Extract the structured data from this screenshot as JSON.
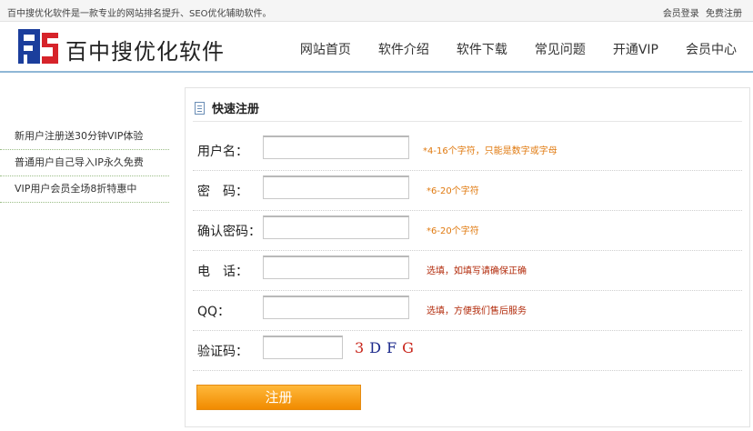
{
  "topbar": {
    "tagline": "百中搜优化软件是一款专业的网站排名提升、SEO优化辅助软件。",
    "links": [
      "会员登录",
      "免费注册"
    ]
  },
  "header": {
    "brand": "百中搜优化软件",
    "nav": [
      "网站首页",
      "软件介绍",
      "软件下载",
      "常见问题",
      "开通VIP",
      "会员中心"
    ]
  },
  "sidebar": {
    "items": [
      "新用户注册送30分钟VIP体验",
      "普通用户自己导入IP永久免费",
      "VIP用户会员全场8折特惠中"
    ]
  },
  "form": {
    "title": "快速注册",
    "fields": [
      {
        "label": "用户名：",
        "value": "",
        "hint": "*4-16个字符，只能是数字或字母"
      },
      {
        "label": "密　码：",
        "value": "",
        "hint": "*6-20个字符"
      },
      {
        "label": "确认密码：",
        "value": "",
        "hint": "*6-20个字符"
      },
      {
        "label": "电　话：",
        "value": "",
        "hint": "选填，如填写请确保正确"
      },
      {
        "label": "QQ：",
        "value": "",
        "hint": "选填，方便我们售后服务"
      },
      {
        "label": "验证码：",
        "value": ""
      }
    ],
    "captcha": [
      "3",
      "D",
      "F",
      "G"
    ],
    "submit_label": "注册"
  },
  "colors": {
    "hint_orange": "#e07a10",
    "hint_red": "#b22a0a",
    "button": "#f5a01a",
    "captcha_red": "#c8241a",
    "captcha_blue": "#1c2a8c"
  }
}
